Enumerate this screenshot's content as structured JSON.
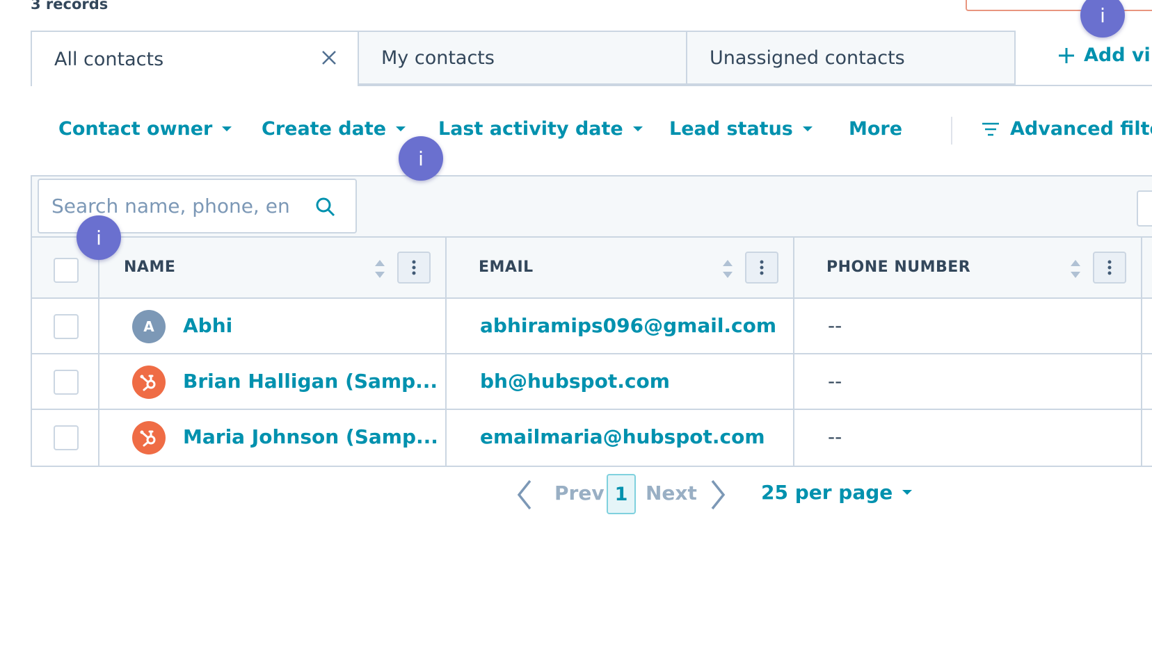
{
  "record_count": "3 records",
  "tabs": [
    {
      "label": "All contacts",
      "active": true
    },
    {
      "label": "My contacts",
      "active": false
    },
    {
      "label": "Unassigned contacts",
      "active": false
    }
  ],
  "add_view_label": "Add vi",
  "filters": {
    "contact_owner": "Contact owner",
    "create_date": "Create date",
    "last_activity_date": "Last activity date",
    "lead_status": "Lead status",
    "more": "More",
    "advanced_filters": "Advanced filte"
  },
  "search": {
    "placeholder": "Search name, phone, en"
  },
  "columns": {
    "name": "NAME",
    "email": "EMAIL",
    "phone": "PHONE NUMBER"
  },
  "rows": [
    {
      "avatar": "A",
      "avatar_type": "letter",
      "name": "Abhi",
      "email": "abhiramips096@gmail.com",
      "phone": "--"
    },
    {
      "avatar": "hubspot-icon",
      "avatar_type": "hubspot",
      "name": "Brian Halligan (Samp...",
      "email": "bh@hubspot.com",
      "phone": "--"
    },
    {
      "avatar": "hubspot-icon",
      "avatar_type": "hubspot",
      "name": "Maria Johnson (Samp...",
      "email": "emailmaria@hubspot.com",
      "phone": "--"
    }
  ],
  "pagination": {
    "prev": "Prev",
    "current_page": "1",
    "next": "Next",
    "per_page": "25 per page"
  },
  "info_marker": "i",
  "colors": {
    "link": "#0091ae",
    "text": "#33475b",
    "border": "#cbd6e2",
    "hubspot": "#ef6c45",
    "info": "#6a70cf"
  }
}
